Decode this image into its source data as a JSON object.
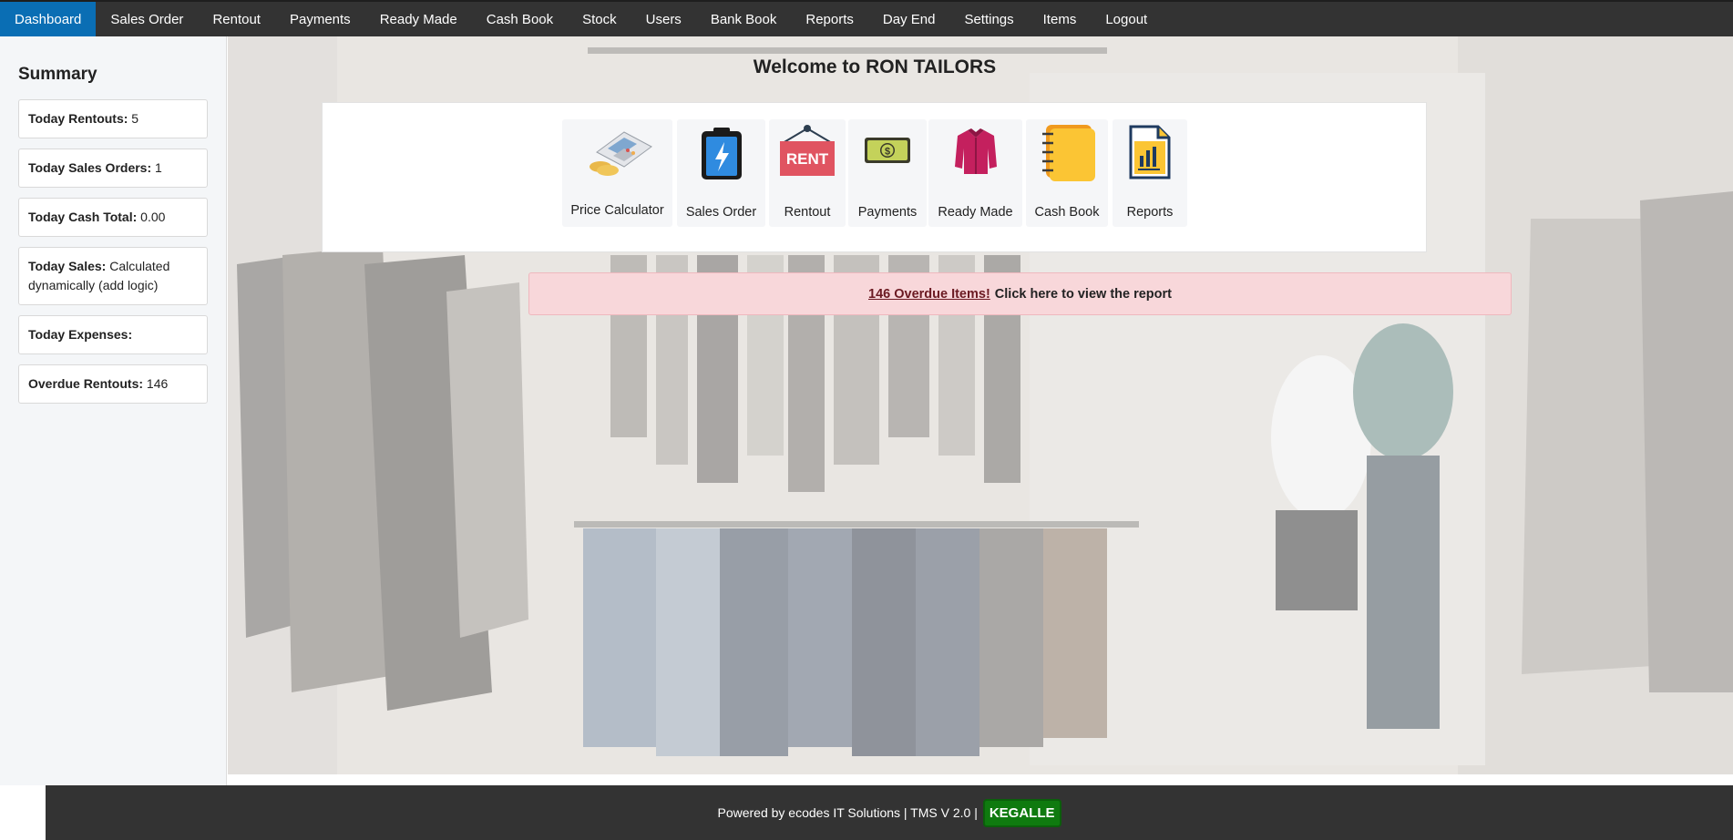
{
  "nav": {
    "items": [
      {
        "label": "Dashboard",
        "active": true
      },
      {
        "label": "Sales Order"
      },
      {
        "label": "Rentout"
      },
      {
        "label": "Payments"
      },
      {
        "label": "Ready Made"
      },
      {
        "label": "Cash Book"
      },
      {
        "label": "Stock"
      },
      {
        "label": "Users"
      },
      {
        "label": "Bank Book"
      },
      {
        "label": "Reports"
      },
      {
        "label": "Day End"
      },
      {
        "label": "Settings"
      },
      {
        "label": "Items"
      },
      {
        "label": "Logout"
      }
    ]
  },
  "sidebar": {
    "title": "Summary",
    "cards": [
      {
        "label": "Today Rentouts:",
        "value": "5"
      },
      {
        "label": "Today Sales Orders:",
        "value": "1"
      },
      {
        "label": "Today Cash Total:",
        "value": "0.00"
      },
      {
        "label": "Today Sales:",
        "value": "Calculated dynamically (add logic)"
      },
      {
        "label": "Today Expenses:",
        "value": ""
      },
      {
        "label": "Overdue Rentouts:",
        "value": "146"
      }
    ]
  },
  "main": {
    "welcome": "Welcome to RON TAILORS",
    "tiles": [
      {
        "label": "Price Calculator",
        "icon": "calculator-icon"
      },
      {
        "label": "Sales Order",
        "icon": "clipboard-bolt-icon"
      },
      {
        "label": "Rentout",
        "icon": "rent-sign-icon",
        "sign_text": "RENT"
      },
      {
        "label": "Payments",
        "icon": "dollar-bill-icon"
      },
      {
        "label": "Ready Made",
        "icon": "jacket-icon"
      },
      {
        "label": "Cash Book",
        "icon": "notebook-icon"
      },
      {
        "label": "Reports",
        "icon": "report-chart-icon"
      }
    ],
    "alert": {
      "link_text": "146 Overdue Items!",
      "message": "Click here to view the report"
    }
  },
  "footer": {
    "text": "Powered by ecodes IT Solutions | TMS V 2.0 |",
    "badge": "KEGALLE"
  },
  "colors": {
    "nav_bg": "#333333",
    "nav_active": "#0a6eb4",
    "alert_bg": "#f8d7da",
    "badge_bg": "#0f7a0f"
  }
}
